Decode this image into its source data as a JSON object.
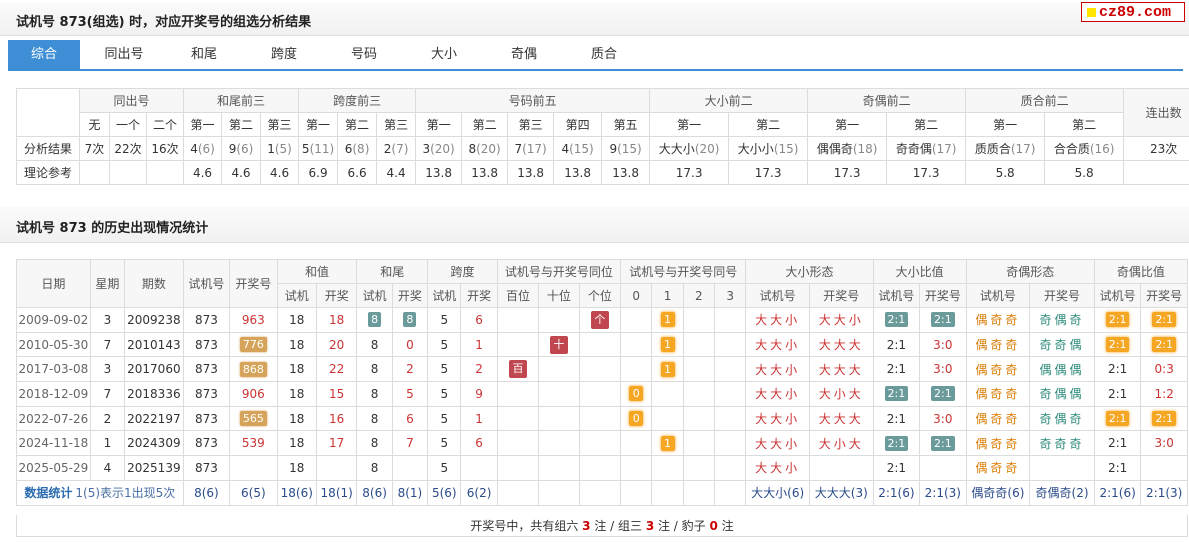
{
  "header1": {
    "title": "试机号 873(组选) 时，对应开奖号的组选分析结果"
  },
  "logo": {
    "text": "cz89.com"
  },
  "tabs": [
    "综合",
    "同出号",
    "和尾",
    "跨度",
    "号码",
    "大小",
    "奇偶",
    "质合"
  ],
  "summary": {
    "groups": [
      "同出号",
      "和尾前三",
      "跨度前三",
      "号码前五",
      "大小前二",
      "奇偶前二",
      "质合前二",
      "连出数"
    ],
    "subheaders": [
      "无",
      "一个",
      "二个",
      "第一",
      "第二",
      "第三",
      "第一",
      "第二",
      "第三",
      "第一",
      "第二",
      "第三",
      "第四",
      "第五",
      "第一",
      "第二",
      "第一",
      "第二",
      "第一",
      "第二"
    ],
    "row_labels": [
      "分析结果",
      "理论参考"
    ],
    "analysis": [
      {
        "v": "7次"
      },
      {
        "v": "22次"
      },
      {
        "v": "16次"
      },
      {
        "v": "4",
        "c": "(6)"
      },
      {
        "v": "9",
        "c": "(6)"
      },
      {
        "v": "1",
        "c": "(5)"
      },
      {
        "v": "5",
        "c": "(11)"
      },
      {
        "v": "6",
        "c": "(8)"
      },
      {
        "v": "2",
        "c": "(7)"
      },
      {
        "v": "3",
        "c": "(20)"
      },
      {
        "v": "8",
        "c": "(20)"
      },
      {
        "v": "7",
        "c": "(17)"
      },
      {
        "v": "4",
        "c": "(15)"
      },
      {
        "v": "9",
        "c": "(15)"
      },
      {
        "v": "大大小",
        "c": "(20)"
      },
      {
        "v": "大小小",
        "c": "(15)"
      },
      {
        "v": "偶偶奇",
        "c": "(18)"
      },
      {
        "v": "奇奇偶",
        "c": "(17)"
      },
      {
        "v": "质质合",
        "c": "(17)"
      },
      {
        "v": "合合质",
        "c": "(16)"
      },
      {
        "v": "23次"
      }
    ],
    "reference": [
      "",
      "",
      "",
      "4.6",
      "4.6",
      "4.6",
      "6.9",
      "6.6",
      "4.4",
      "13.8",
      "13.8",
      "13.8",
      "13.8",
      "13.8",
      "17.3",
      "17.3",
      "17.3",
      "17.3",
      "5.8",
      "5.8",
      ""
    ]
  },
  "header2": {
    "title": "试机号 873 的历史出现情况统计"
  },
  "history": {
    "head1": [
      "日期",
      "星期",
      "期数",
      "试机号",
      "开奖号",
      "和值",
      "和尾",
      "跨度",
      "试机号与开奖号同位",
      "试机号与开奖号同号",
      "大小形态",
      "大小比值",
      "奇偶形态",
      "奇偶比值"
    ],
    "head2": [
      "试机",
      "开奖",
      "试机",
      "开奖",
      "试机",
      "开奖",
      "百位",
      "十位",
      "个位",
      "0",
      "1",
      "2",
      "3",
      "试机号",
      "开奖号",
      "试机号",
      "开奖号",
      "试机号",
      "开奖号",
      "试机号",
      "开奖号"
    ],
    "rows": [
      {
        "date": "2009-09-02",
        "week": "3",
        "issue": "2009238",
        "test": "873",
        "draw": "963",
        "drawStyle": "red",
        "sumT": "18",
        "sumD": "18",
        "tailT": "8",
        "tailD": "8",
        "tailBadge": true,
        "spanT": "5",
        "spanD": "6",
        "pos": [
          "",
          "",
          "个"
        ],
        "same": [
          "",
          "1",
          "",
          ""
        ],
        "dxT": "大大小",
        "dxD": "大大小",
        "dxrT": "2:1",
        "dxrD": "2:1",
        "dxrBadge": true,
        "joT": "偶奇奇",
        "joD": "奇偶奇",
        "jorT": "2:1",
        "jorD": "2:1",
        "jorBadge": true
      },
      {
        "date": "2010-05-30",
        "week": "7",
        "issue": "2010143",
        "test": "873",
        "draw": "776",
        "drawStyle": "tan",
        "sumT": "18",
        "sumD": "20",
        "tailT": "8",
        "tailD": "0",
        "tailBadge": false,
        "spanT": "5",
        "spanD": "1",
        "pos": [
          "",
          "十",
          ""
        ],
        "same": [
          "",
          "1",
          "",
          ""
        ],
        "dxT": "大大小",
        "dxD": "大大大",
        "dxrT": "2:1",
        "dxrD": "3:0",
        "dxrBadge": false,
        "joT": "偶奇奇",
        "joD": "奇奇偶",
        "jorT": "2:1",
        "jorD": "2:1",
        "jorBadge": true
      },
      {
        "date": "2017-03-08",
        "week": "3",
        "issue": "2017060",
        "test": "873",
        "draw": "868",
        "drawStyle": "tan",
        "sumT": "18",
        "sumD": "22",
        "tailT": "8",
        "tailD": "2",
        "tailBadge": false,
        "spanT": "5",
        "spanD": "2",
        "pos": [
          "百",
          "",
          ""
        ],
        "same": [
          "",
          "1",
          "",
          ""
        ],
        "dxT": "大大小",
        "dxD": "大大大",
        "dxrT": "2:1",
        "dxrD": "3:0",
        "dxrBadge": false,
        "joT": "偶奇奇",
        "joD": "偶偶偶",
        "jorT": "2:1",
        "jorD": "0:3",
        "jorBadge": false
      },
      {
        "date": "2018-12-09",
        "week": "7",
        "issue": "2018336",
        "test": "873",
        "draw": "906",
        "drawStyle": "red",
        "sumT": "18",
        "sumD": "15",
        "tailT": "8",
        "tailD": "5",
        "tailBadge": false,
        "spanT": "5",
        "spanD": "9",
        "pos": [
          "",
          "",
          ""
        ],
        "same": [
          "0",
          "",
          "",
          ""
        ],
        "dxT": "大大小",
        "dxD": "大小大",
        "dxrT": "2:1",
        "dxrD": "2:1",
        "dxrBadge": true,
        "joT": "偶奇奇",
        "joD": "奇偶偶",
        "jorT": "2:1",
        "jorD": "1:2",
        "jorBadge": false
      },
      {
        "date": "2022-07-26",
        "week": "2",
        "issue": "2022197",
        "test": "873",
        "draw": "565",
        "drawStyle": "tan",
        "sumT": "18",
        "sumD": "16",
        "tailT": "8",
        "tailD": "6",
        "tailBadge": false,
        "spanT": "5",
        "spanD": "1",
        "pos": [
          "",
          "",
          ""
        ],
        "same": [
          "0",
          "",
          "",
          ""
        ],
        "dxT": "大大小",
        "dxD": "大大大",
        "dxrT": "2:1",
        "dxrD": "3:0",
        "dxrBadge": false,
        "joT": "偶奇奇",
        "joD": "奇偶奇",
        "jorT": "2:1",
        "jorD": "2:1",
        "jorBadge": true
      },
      {
        "date": "2024-11-18",
        "week": "1",
        "issue": "2024309",
        "test": "873",
        "draw": "539",
        "drawStyle": "red",
        "sumT": "18",
        "sumD": "17",
        "tailT": "8",
        "tailD": "7",
        "tailBadge": false,
        "spanT": "5",
        "spanD": "6",
        "pos": [
          "",
          "",
          ""
        ],
        "same": [
          "",
          "1",
          "",
          ""
        ],
        "dxT": "大大小",
        "dxD": "大小大",
        "dxrT": "2:1",
        "dxrD": "2:1",
        "dxrBadge": true,
        "joT": "偶奇奇",
        "joD": "奇奇奇",
        "jorT": "2:1",
        "jorD": "3:0",
        "jorBadge": false
      },
      {
        "date": "2025-05-29",
        "week": "4",
        "issue": "2025139",
        "test": "873",
        "draw": "",
        "drawStyle": "",
        "sumT": "18",
        "sumD": "",
        "tailT": "8",
        "tailD": "",
        "tailBadge": false,
        "spanT": "5",
        "spanD": "",
        "pos": [
          "",
          "",
          ""
        ],
        "same": [
          "",
          "",
          "",
          ""
        ],
        "dxT": "大大小",
        "dxD": "",
        "dxrT": "2:1",
        "dxrD": "",
        "dxrBadge": false,
        "joT": "偶奇奇",
        "joD": "",
        "jorT": "2:1",
        "jorD": "",
        "jorBadge": false
      }
    ],
    "stats": {
      "label": "数据统计",
      "note": "1(5)表示1出现5次",
      "cells": [
        "8(6)",
        "6(5)",
        "18(6)",
        "18(1)",
        "8(6)",
        "8(1)",
        "5(6)",
        "6(2)",
        "",
        "",
        "",
        "",
        "",
        "",
        "",
        "大大小(6)",
        "大大大(3)",
        "2:1(6)",
        "2:1(3)",
        "偶奇奇(6)",
        "奇偶奇(2)",
        "2:1(6)",
        "2:1(3)"
      ]
    },
    "footer": {
      "pre": "开奖号中，共有组六 ",
      "a": "3",
      "mid1": " 注 / 组三 ",
      "b": "3",
      "mid2": " 注 / 豹子 ",
      "c": "0",
      "post": " 注"
    }
  }
}
